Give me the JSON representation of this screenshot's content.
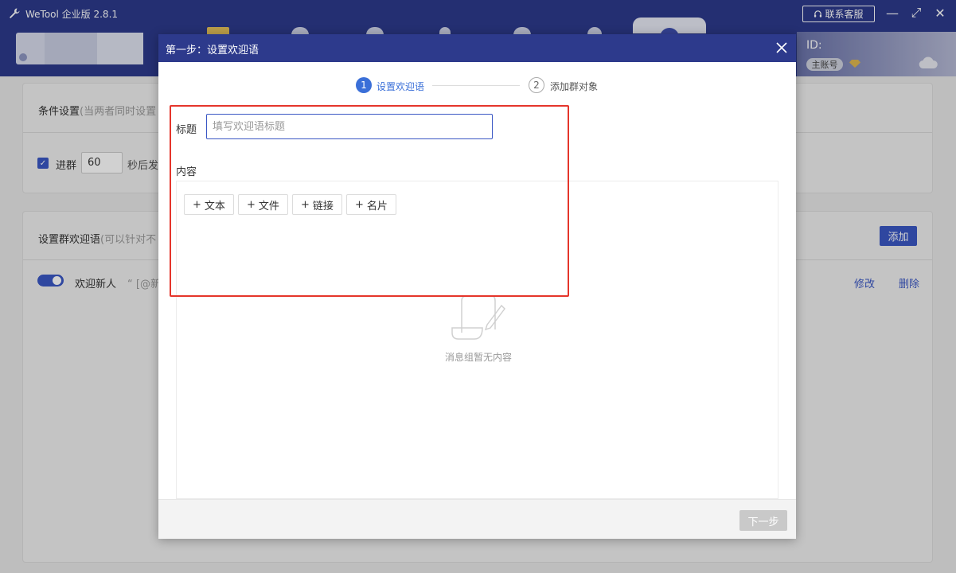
{
  "window": {
    "app_title": "WeTool 企业版 2.8.1",
    "contact_label": "联系客服",
    "minimize_icon": "—",
    "maximize_icon": "⤢",
    "close_icon": "✕"
  },
  "account": {
    "id_label": "ID:",
    "role_badge": "主账号"
  },
  "page": {
    "condition_title": "条件设置",
    "condition_hint": "(当两者同时设置",
    "join_label": "进群",
    "join_delay_value": "60",
    "join_suffix": "秒后发",
    "welcome_title": "设置群欢迎语",
    "welcome_hint": "(可以针对不",
    "add_button": "添加",
    "row": {
      "name": "欢迎新人",
      "preview": "“ [@新",
      "edit": "修改",
      "delete": "删除",
      "enabled": true
    }
  },
  "modal": {
    "title": "第一步：设置欢迎语",
    "steps": [
      {
        "number": "1",
        "label": "设置欢迎语",
        "active": true
      },
      {
        "number": "2",
        "label": "添加群对象",
        "active": false
      }
    ],
    "title_field_label": "标题",
    "title_field_placeholder": "填写欢迎语标题",
    "title_field_value": "",
    "content_label": "内容",
    "toolbar": [
      {
        "plus": "+",
        "label": "文本"
      },
      {
        "plus": "+",
        "label": "文件"
      },
      {
        "plus": "+",
        "label": "链接"
      },
      {
        "plus": "+",
        "label": "名片"
      }
    ],
    "empty_text": "消息组暂无内容",
    "next_button": "下一步"
  },
  "colors": {
    "header_bg": "#2d3a8c",
    "accent": "#3a57c4",
    "step_active": "#3a6fd8",
    "highlight": "#e5352b",
    "disabled_button": "#c9c9c9"
  }
}
